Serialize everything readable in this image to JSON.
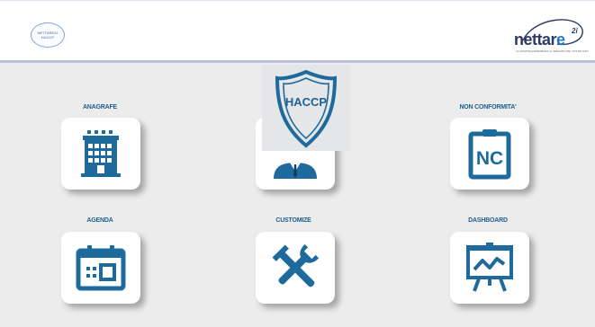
{
  "header": {
    "app_badge_line1": "NETTARE21",
    "app_badge_line2": "HACCP",
    "brand_word": "nettar",
    "brand_e": "e",
    "brand_sup": "2i",
    "brand_tagline": "LA NOSTRA ESPERIENZA AL SERVIZIO DEI VOSTRI DATI"
  },
  "tiles": {
    "anagrafe": {
      "label": "ANAGRAFE"
    },
    "haccp": {
      "label": "HACCP"
    },
    "non_conformita": {
      "label": "NON CONFORMITA'",
      "icon_text": "NC"
    },
    "agenda": {
      "label": "AGENDA"
    },
    "customize": {
      "label": "CUSTOMIZE"
    },
    "dashboard": {
      "label": "DASHBOARD"
    }
  },
  "colors": {
    "background": "#ececec",
    "icon_blue": "#1f6a9c",
    "label_blue": "#1f6091"
  },
  "icons": {
    "anagrafe": "building-icon",
    "haccp": "user-shield-icon",
    "non_conformita": "clipboard-icon",
    "agenda": "calendar-icon",
    "customize": "tools-icon",
    "dashboard": "presentation-chart-icon"
  }
}
